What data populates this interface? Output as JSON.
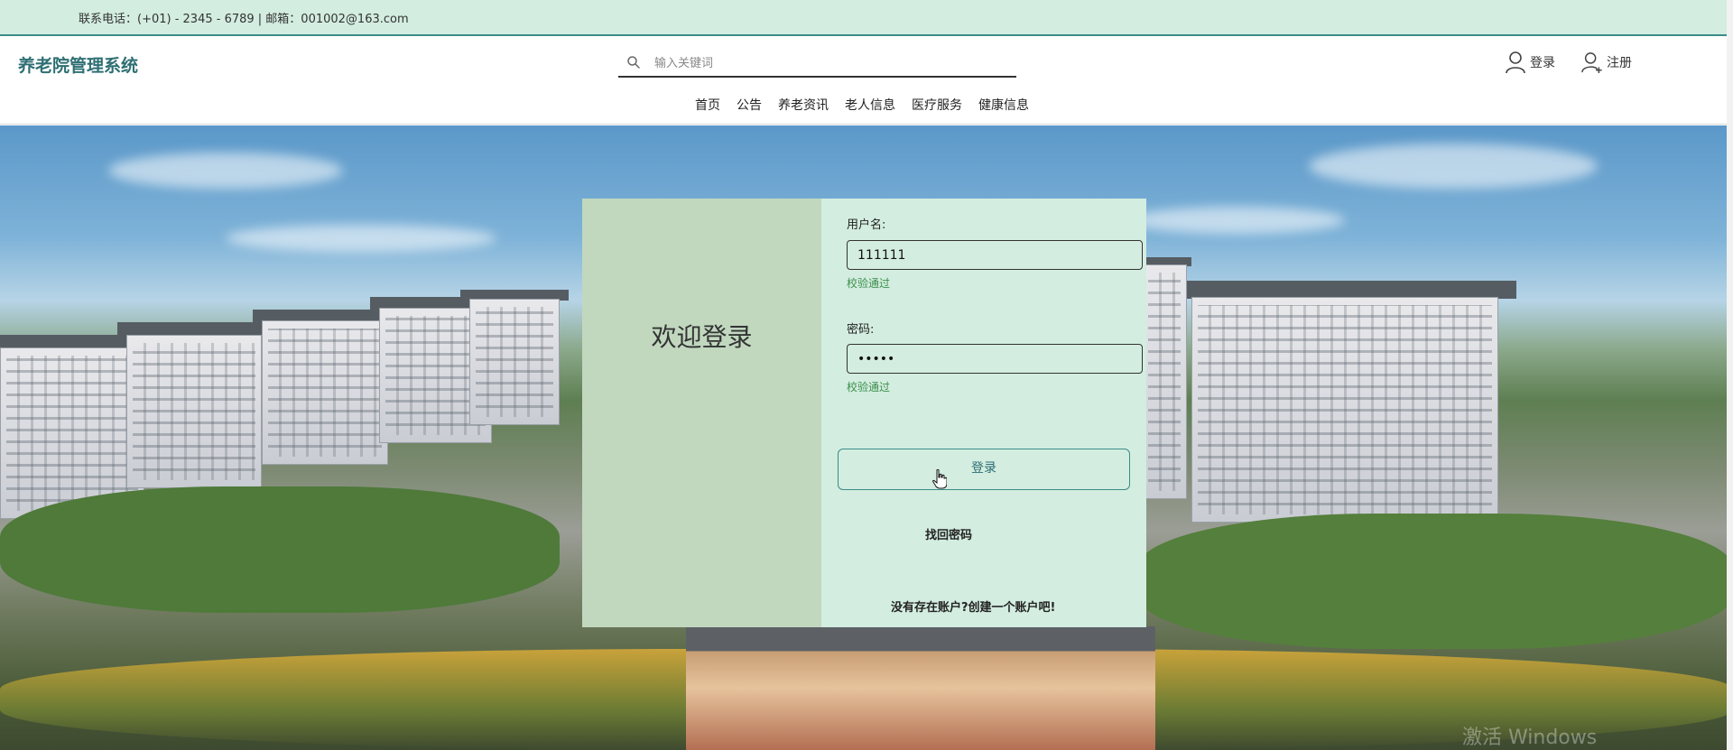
{
  "topbar": {
    "contact": "联系电话：(+01) - 2345 - 6789 | 邮箱：001002@163.com"
  },
  "header": {
    "brand": "养老院管理系统",
    "search_placeholder": "输入关键词",
    "login_label": "登录",
    "register_label": "注册"
  },
  "nav": {
    "items": [
      "首页",
      "公告",
      "养老资讯",
      "老人信息",
      "医疗服务",
      "健康信息"
    ]
  },
  "login": {
    "welcome": "欢迎登录",
    "username_label": "用户名:",
    "username_value": "111111",
    "username_status": "校验通过",
    "password_label": "密码:",
    "password_value": "•••••",
    "password_status": "校验通过",
    "submit_label": "登录",
    "forgot_label": "找回密码",
    "create_account_label": "没有存在账户?创建一个账户吧!"
  },
  "colors": {
    "accent": "#3a8c88",
    "brand_text": "#2e6f73",
    "panel_light": "#d3ede0",
    "panel_dark": "#c1d8bf",
    "valid_text": "#3c8f4a"
  },
  "icons": {
    "search": "search-icon",
    "login": "user-icon",
    "register": "user-add-icon"
  }
}
